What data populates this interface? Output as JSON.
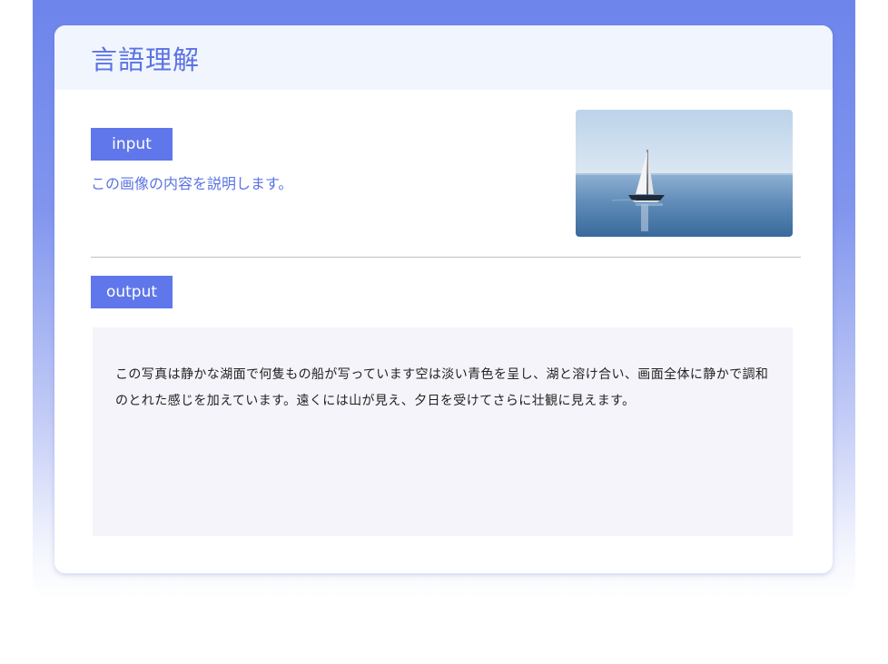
{
  "card": {
    "title": "言語理解"
  },
  "input_section": {
    "badge_label": "input",
    "prompt": "この画像の内容を説明します。",
    "image": "sailboat-on-calm-sea-photo"
  },
  "output_section": {
    "badge_label": "output",
    "text": "この写真は静かな湖面で何隻もの船が写っています空は淡い青色を呈し、湖と溶け合い、画面全体に静かで調和のとれた感じを加えています。遠くには山が見え、夕日を受けてさらに壮観に見えます。"
  },
  "colors": {
    "accent": "#5f77ea",
    "title_text": "#5b73e4",
    "header_bg": "#f1f6fe",
    "output_bg": "#f4f4fa",
    "frame_top": "#6d85ec"
  }
}
